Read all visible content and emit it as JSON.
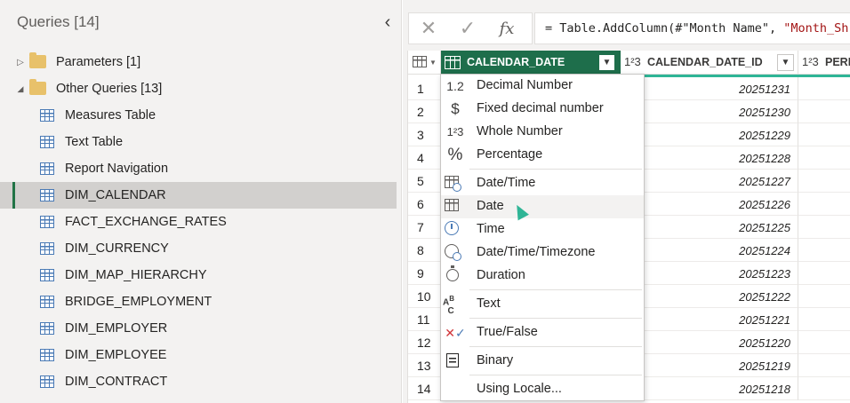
{
  "left_pane": {
    "title": "Queries [14]",
    "collapse_glyph": "‹",
    "folders": [
      {
        "label": "Parameters [1]",
        "expanded": false,
        "caret": "▷"
      },
      {
        "label": "Other Queries [13]",
        "expanded": true,
        "caret": "◢"
      }
    ],
    "queries": [
      "Measures Table",
      "Text Table",
      "Report Navigation",
      "DIM_CALENDAR",
      "FACT_EXCHANGE_RATES",
      "DIM_CURRENCY",
      "DIM_MAP_HIERARCHY",
      "BRIDGE_EMPLOYMENT",
      "DIM_EMPLOYER",
      "DIM_EMPLOYEE",
      "DIM_CONTRACT"
    ],
    "selected_query": "DIM_CALENDAR"
  },
  "formula_bar": {
    "cancel_glyph": "✕",
    "commit_glyph": "✓",
    "fx_label": "fx",
    "formula_prefix": "= Table.AddColumn(#\"Month Name\", ",
    "formula_string": "\"Month_Sh"
  },
  "grid": {
    "columns": [
      {
        "name": "CALENDAR_DATE",
        "type_icon": "calendar-icon",
        "selected": true
      },
      {
        "name": "CALENDAR_DATE_ID",
        "type_icon": "1²3"
      },
      {
        "name": "PERI",
        "type_icon": "1²3"
      }
    ],
    "rows": [
      {
        "n": "1",
        "id": "20251231"
      },
      {
        "n": "2",
        "id": "20251230"
      },
      {
        "n": "3",
        "id": "20251229"
      },
      {
        "n": "4",
        "id": "20251228"
      },
      {
        "n": "5",
        "id": "20251227"
      },
      {
        "n": "6",
        "id": "20251226"
      },
      {
        "n": "7",
        "id": "20251225"
      },
      {
        "n": "8",
        "id": "20251224"
      },
      {
        "n": "9",
        "id": "20251223"
      },
      {
        "n": "10",
        "id": "20251222"
      },
      {
        "n": "11",
        "id": "20251221"
      },
      {
        "n": "12",
        "id": "20251220"
      },
      {
        "n": "13",
        "id": "20251219"
      },
      {
        "n": "14",
        "id": "20251218"
      }
    ]
  },
  "type_menu": {
    "items": [
      {
        "label": "Decimal Number",
        "icon": "1.2"
      },
      {
        "label": "Fixed decimal number",
        "icon": "$"
      },
      {
        "label": "Whole Number",
        "icon": "1²3"
      },
      {
        "label": "Percentage",
        "icon": "%"
      },
      {
        "label": "Date/Time",
        "icon": "datetime-icon"
      },
      {
        "label": "Date",
        "icon": "date-icon",
        "hovered": true
      },
      {
        "label": "Time",
        "icon": "clock-icon"
      },
      {
        "label": "Date/Time/Timezone",
        "icon": "globe-icon"
      },
      {
        "label": "Duration",
        "icon": "stopwatch-icon"
      },
      {
        "label": "Text",
        "icon": "ABC"
      },
      {
        "label": "True/False",
        "icon": "true-false-icon"
      },
      {
        "label": "Binary",
        "icon": "binary-icon"
      },
      {
        "label": "Using Locale...",
        "icon": ""
      }
    ]
  },
  "colors": {
    "selected_column": "#1e6e4b",
    "quality_bar": "#2fb596",
    "selection_accent": "#217346",
    "folder": "#e8c16a",
    "table_icon": "#4a7ab5"
  }
}
